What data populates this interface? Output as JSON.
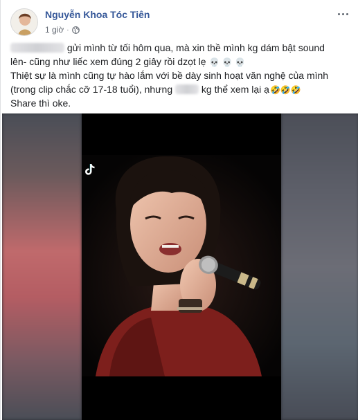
{
  "post": {
    "author": "Nguyễn Khoa Tóc Tiên",
    "time": "1 giờ",
    "separator": "·",
    "privacy_icon": "globe-icon",
    "more_icon": "more-options-icon",
    "lines": {
      "l1": "gửi mình từ tối hôm qua, mà xin thề mình kg dám bật sound",
      "l2": "lên- cũng như liếc xem đúng 2 giây rồi dzọt lẹ",
      "l2_emoji": "💀 💀 💀",
      "l3": "Thiệt sự là mình cũng tự hào lắm với bề dày sinh hoạt văn nghệ của mình",
      "l4a": "(trong clip chắc cỡ 17-18 tuổi), nhưng",
      "l4b": "kg thể xem lại ạ",
      "l4_emoji": "🤣🤣🤣",
      "l5": "Share thì oke."
    }
  },
  "video": {
    "watermark_icon": "tiktok-icon"
  },
  "colors": {
    "author": "#365899",
    "meta": "#616770",
    "text": "#1c1e21"
  }
}
